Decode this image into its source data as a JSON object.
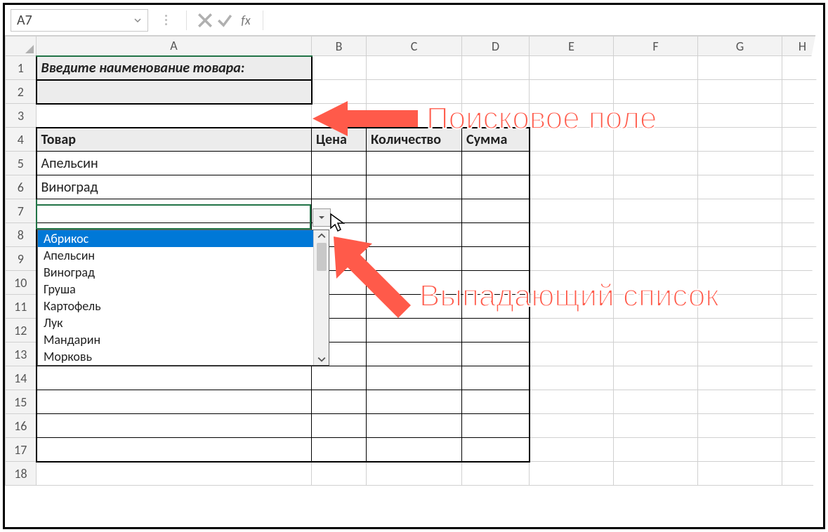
{
  "namebox": {
    "value": "A7"
  },
  "formulabar": {
    "cancel": "✕",
    "enter": "✓",
    "fx": "fx",
    "value": ""
  },
  "columns": [
    "A",
    "B",
    "C",
    "D",
    "E",
    "F",
    "G",
    "H"
  ],
  "rows": [
    "1",
    "2",
    "3",
    "4",
    "5",
    "6",
    "7",
    "8",
    "9",
    "10",
    "11",
    "12",
    "13",
    "14",
    "15",
    "16",
    "17",
    "18"
  ],
  "cells": {
    "A1": "Введите наименование товара:",
    "A2": "",
    "A4": "Товар",
    "B4": "Цена",
    "C4": "Количество",
    "D4": "Сумма",
    "A5": "Апельсин",
    "A6": "Виноград",
    "A7": ""
  },
  "dropdown": {
    "items": [
      "Абрикос",
      "Апельсин",
      "Виноград",
      "Груша",
      "Картофель",
      "Лук",
      "Мандарин",
      "Морковь"
    ],
    "selectedIndex": 0
  },
  "annotations": {
    "search": "Поисковое поле",
    "dropdown": "Выпадающий список"
  }
}
